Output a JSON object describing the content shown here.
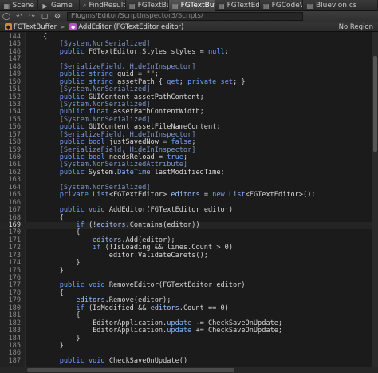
{
  "tabs": [
    {
      "label": "Scene",
      "icon": "scene-icon"
    },
    {
      "label": "Game",
      "icon": "game-icon"
    },
    {
      "label": "FindResults\\",
      "icon": "search-icon"
    },
    {
      "label": "FGTextBuffe",
      "icon": "script-icon"
    },
    {
      "label": "FGTextBuffe",
      "icon": "script-icon",
      "active": true
    },
    {
      "label": "FGTextEdito",
      "icon": "script-icon"
    },
    {
      "label": "FGCodeWin",
      "icon": "script-icon"
    },
    {
      "label": "Bluevion.cs",
      "icon": "script-icon"
    }
  ],
  "toolbar": {
    "path": "Plugins/Editor/ScriptInspector3/Scripts/"
  },
  "breadcrumbs": {
    "items": [
      {
        "label": "FGTextBuffer",
        "icon": "class-icon"
      },
      {
        "label": "AddEditor (FGTextEditor editor)",
        "icon": "method-icon"
      }
    ],
    "region": "No Region"
  },
  "code_lines": [
    {
      "num": "144",
      "html": "{"
    },
    {
      "num": "145",
      "html": "    <span class=\"a\">[System.NonSerialized]</span>"
    },
    {
      "num": "146",
      "html": "    <span class=\"k\">public</span> FGTextEditor.Styles styles = <span class=\"k\">null</span>;"
    },
    {
      "num": "147",
      "html": ""
    },
    {
      "num": "148",
      "html": "    <span class=\"a\">[SerializeField, HideInInspector]</span>"
    },
    {
      "num": "149",
      "html": "    <span class=\"k\">public</span> <span class=\"k\">string</span> guid = <span class=\"s\">\"\"</span>;"
    },
    {
      "num": "150",
      "html": "    <span class=\"k\">public</span> <span class=\"k\">string</span> assetPath { <span class=\"k\">get</span>; <span class=\"k\">private</span> <span class=\"k\">set</span>; }"
    },
    {
      "num": "151",
      "html": "    <span class=\"a\">[System.NonSerialized]</span>"
    },
    {
      "num": "152",
      "html": "    <span class=\"k\">public</span> GUIContent assetPathContent;"
    },
    {
      "num": "153",
      "html": "    <span class=\"a\">[System.NonSerialized]</span>"
    },
    {
      "num": "154",
      "html": "    <span class=\"k\">public</span> <span class=\"k\">float</span> assetPathContentWidth;"
    },
    {
      "num": "155",
      "html": "    <span class=\"a\">[System.NonSerialized]</span>"
    },
    {
      "num": "156",
      "html": "    <span class=\"k\">public</span> GUIContent assetFileNameContent;"
    },
    {
      "num": "157",
      "html": "    <span class=\"a\">[SerializeField, HideInInspector]</span>"
    },
    {
      "num": "158",
      "html": "    <span class=\"k\">public</span> <span class=\"k\">bool</span> justSavedNow = <span class=\"k\">false</span>;"
    },
    {
      "num": "159",
      "html": "    <span class=\"a\">[SerializeField, HideInInspector]</span>"
    },
    {
      "num": "160",
      "html": "    <span class=\"k\">public</span> <span class=\"k\">bool</span> needsReload = <span class=\"k\">true</span>;"
    },
    {
      "num": "161",
      "html": "    <span class=\"a\">[System.NonSerializedAttribute]</span>"
    },
    {
      "num": "162",
      "html": "    <span class=\"k\">public</span> System.<span class=\"t\">DateTime</span> lastModifiedTime;"
    },
    {
      "num": "163",
      "html": ""
    },
    {
      "num": "164",
      "html": "    <span class=\"a\">[System.NonSerialized]</span>"
    },
    {
      "num": "165",
      "html": "    <span class=\"k\">private</span> <span class=\"t\">List</span>&lt;FGTextEditor&gt; <span class=\"id\">editors</span> = <span class=\"k\">new</span> <span class=\"t\">List</span>&lt;FGTextEditor&gt;();"
    },
    {
      "num": "166",
      "html": ""
    },
    {
      "num": "167",
      "html": "    <span class=\"k\">public</span> <span class=\"k\">void</span> AddEditor(FGTextEditor editor)"
    },
    {
      "num": "168",
      "html": "    {"
    },
    {
      "num": "169",
      "html": "        <span class=\"k\">if</span> (!<span class=\"id\">editors</span>.Contains(editor))",
      "current": true
    },
    {
      "num": "170",
      "html": "        {"
    },
    {
      "num": "171",
      "html": "            <span class=\"id\">editors</span>.Add(editor);"
    },
    {
      "num": "172",
      "html": "            <span class=\"k\">if</span> (!IsLoading &amp;&amp; lines.Count &gt; 0)"
    },
    {
      "num": "173",
      "html": "                editor.ValidateCarets();"
    },
    {
      "num": "174",
      "html": "        }"
    },
    {
      "num": "175",
      "html": "    }"
    },
    {
      "num": "176",
      "html": ""
    },
    {
      "num": "177",
      "html": "    <span class=\"k\">public</span> <span class=\"k\">void</span> RemoveEditor(FGTextEditor editor)"
    },
    {
      "num": "178",
      "html": "    {"
    },
    {
      "num": "179",
      "html": "        <span class=\"id\">editors</span>.Remove(editor);"
    },
    {
      "num": "180",
      "html": "        <span class=\"k\">if</span> (IsModified &amp;&amp; <span class=\"id\">editors</span>.Count == 0)"
    },
    {
      "num": "181",
      "html": "        {"
    },
    {
      "num": "182",
      "html": "            EditorApplication.<span class=\"t\">update</span> -= CheckSaveOnUpdate;"
    },
    {
      "num": "183",
      "html": "            EditorApplication.<span class=\"t\">update</span> += CheckSaveOnUpdate;"
    },
    {
      "num": "184",
      "html": "        }"
    },
    {
      "num": "185",
      "html": "    }"
    },
    {
      "num": "186",
      "html": ""
    },
    {
      "num": "187",
      "html": "    <span class=\"k\">public</span> <span class=\"k\">void</span> CheckSaveOnUpdate()"
    }
  ]
}
